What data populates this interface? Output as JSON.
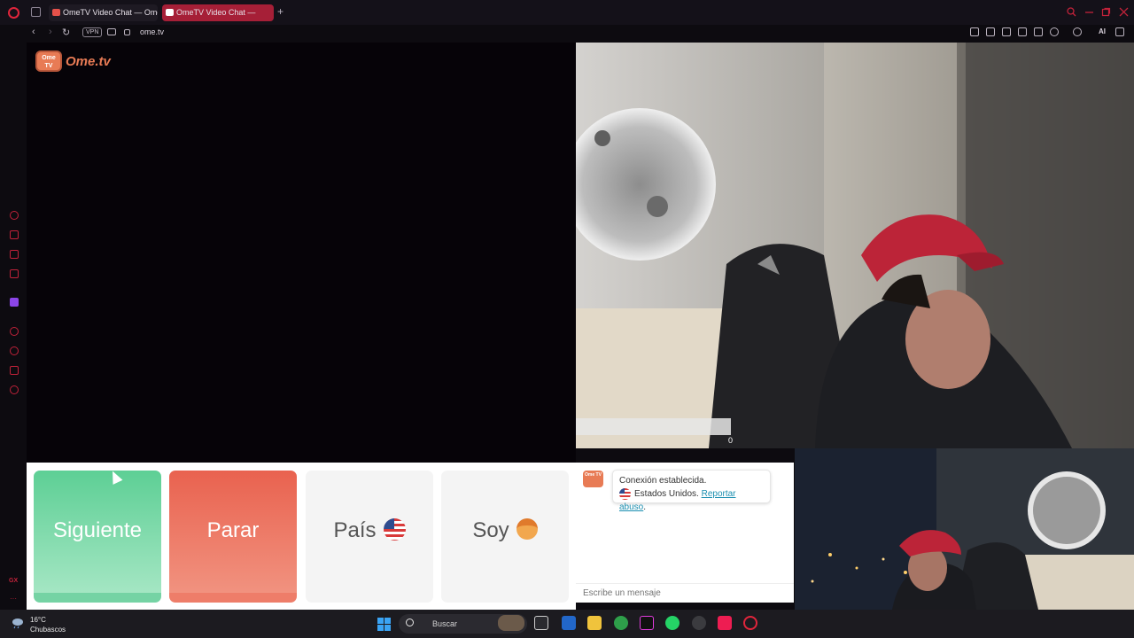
{
  "browser": {
    "tabs": [
      {
        "label": "OmeTV Video Chat — Ome"
      },
      {
        "label": "OmeTV Video Chat —"
      }
    ],
    "new_tab": "+",
    "url": "ome.tv",
    "vpn_badge": "VPN",
    "ai_label": "AI"
  },
  "sidebar": {
    "gx_label": "GX",
    "more_label": "···"
  },
  "site": {
    "logo_badge": "Ome TV",
    "logo_text": "Ome.tv"
  },
  "controls": {
    "next_label": "Siguiente",
    "stop_label": "Parar",
    "country_label": "País",
    "gender_label": "Soy"
  },
  "chat": {
    "logo_badge": "Ome TV",
    "status_line": "Conexión establecida.",
    "country_line": "Estados Unidos.",
    "report_link": "Reportar abuso",
    "report_suffix": ".",
    "input_placeholder": "Escribe un mensaje"
  },
  "remote_video": {
    "overlay_count": "0"
  },
  "taskbar": {
    "temperature": "16°C",
    "weather": "Chubascos",
    "search_placeholder": "Buscar"
  },
  "colors": {
    "brand_orange": "#e87b55",
    "next_green": "#5dcf95",
    "stop_red": "#e9624f",
    "opera_red": "#c2223a"
  }
}
